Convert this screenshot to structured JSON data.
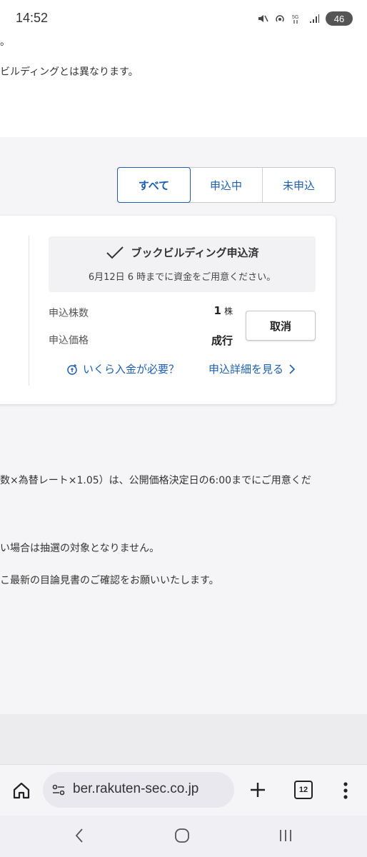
{
  "status_bar": {
    "time": "14:52",
    "battery": "46"
  },
  "top": {
    "line1": "。",
    "line2": "ビルディングとは異なります。"
  },
  "filter_tabs": [
    {
      "label": "すべて",
      "active": true
    },
    {
      "label": "申込中",
      "active": false
    },
    {
      "label": "未申込",
      "active": false
    }
  ],
  "card": {
    "status_title": "ブックビルディング申込済",
    "status_sub": "6月12日 6 時までに資金をご用意ください。",
    "shares_label": "申込株数",
    "shares_value": "1",
    "shares_unit": "株",
    "price_label": "申込価格",
    "price_value": "成行",
    "cancel_label": "取消",
    "deposit_link": "いくら入金が必要？",
    "details_link": "申込詳細を見る"
  },
  "body": {
    "line1": "数×為替レート×1.05）は、公開価格決定日の6:00までにご用意くだ",
    "line2": "い場合は抽選の対象となりません。",
    "line3": "こ最新の目論見書のご確認をお願いいたします。"
  },
  "browser": {
    "url": "ber.rakuten-sec.co.jp",
    "tab_count": "12"
  }
}
